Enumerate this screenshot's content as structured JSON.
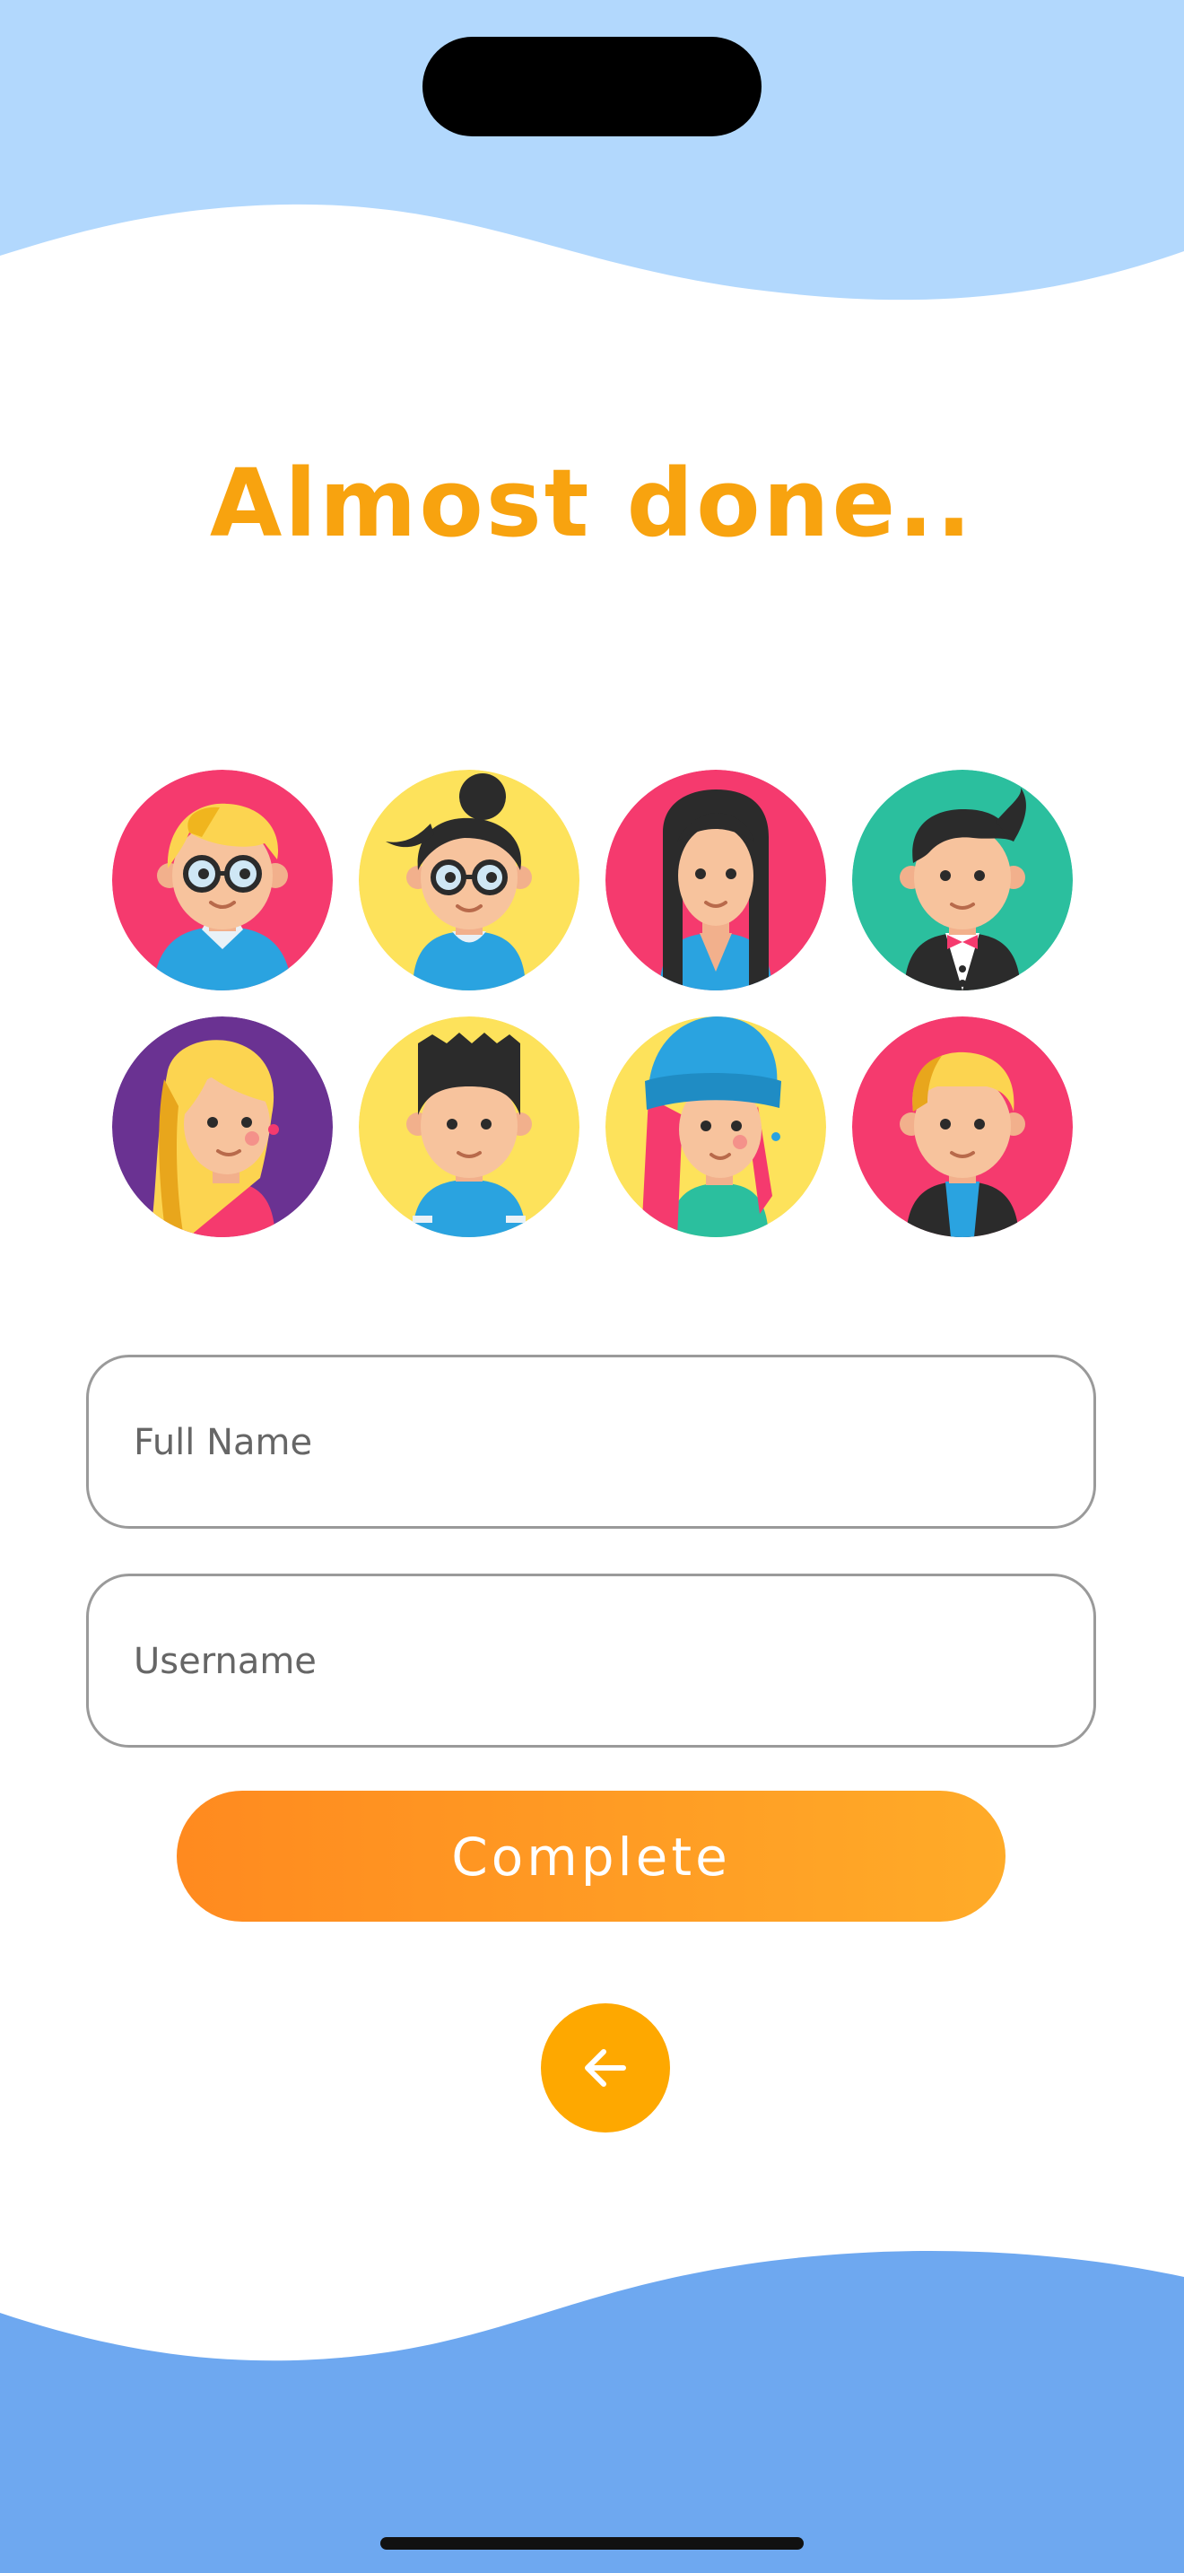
{
  "screen": {
    "title": "Almost done..",
    "colors": {
      "title": "#f8a30f",
      "wave_top": "#b2d8fd",
      "wave_bottom": "#6ea8f0",
      "button_gradient_start": "#ff8a1f",
      "button_gradient_end": "#ffab28",
      "back_button": "#fea800"
    }
  },
  "avatars": [
    {
      "name": "blonde-glasses-boy",
      "background": "#f53a6e"
    },
    {
      "name": "bun-glasses-girl",
      "background": "#fde25b"
    },
    {
      "name": "long-black-hair-person",
      "background": "#f53a6e"
    },
    {
      "name": "tuxedo-bowtie-man",
      "background": "#2bbf9e"
    },
    {
      "name": "blonde-girl",
      "background": "#6a3292"
    },
    {
      "name": "spiky-hair-boy",
      "background": "#fde25b"
    },
    {
      "name": "beanie-pink-hair-girl",
      "background": "#fde25b"
    },
    {
      "name": "blonde-jacket-man",
      "background": "#f53a6e"
    }
  ],
  "form": {
    "full_name": {
      "placeholder": "Full Name",
      "value": ""
    },
    "username": {
      "placeholder": "Username",
      "value": ""
    }
  },
  "actions": {
    "complete_label": "Complete",
    "back_icon": "arrow-left-icon"
  }
}
